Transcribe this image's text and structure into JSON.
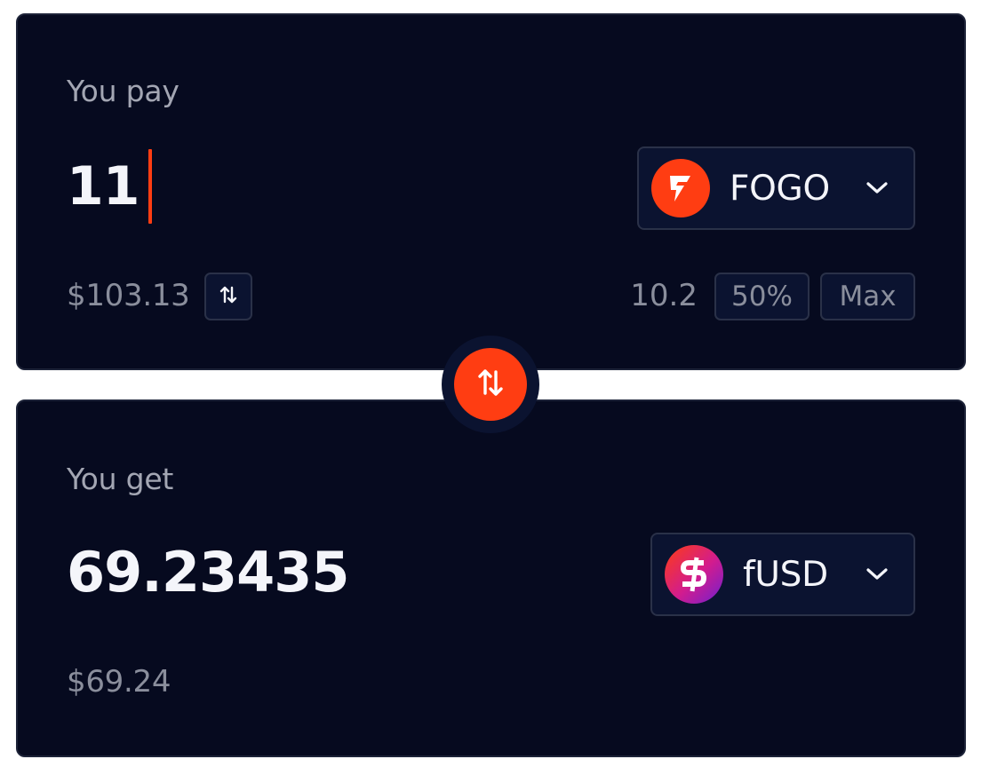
{
  "pay": {
    "label": "You pay",
    "amount": "11",
    "token": {
      "symbol": "FOGO",
      "icon": "fogo-bolt-logo",
      "color": "#ff3d12"
    },
    "usd_value": "$103.13",
    "balance": "10.2",
    "percent_label": "50%",
    "max_label": "Max"
  },
  "get": {
    "label": "You get",
    "amount": "69.23435",
    "token": {
      "symbol": "fUSD",
      "icon": "fusd-dollar-logo"
    },
    "usd_value": "$69.24"
  },
  "colors": {
    "card_bg": "#060a1f",
    "accent": "#ff3d12",
    "text_primary": "#f4f5fa",
    "text_muted": "#8a8e9c"
  }
}
